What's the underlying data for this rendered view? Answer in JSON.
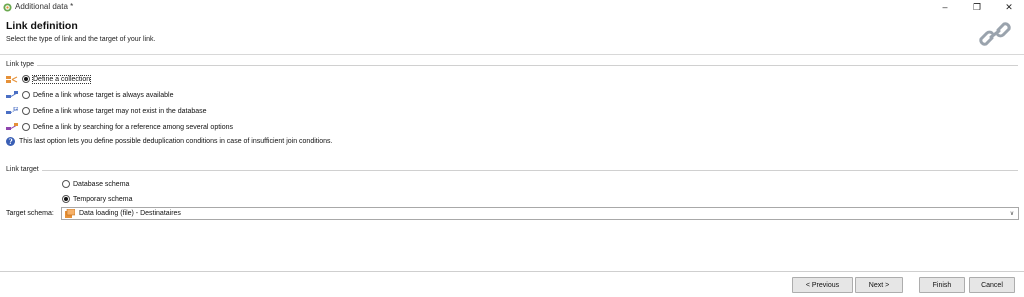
{
  "window": {
    "title": "Additional data *",
    "minimize_glyph": "–",
    "maximize_glyph": "❐",
    "close_glyph": "✕"
  },
  "header": {
    "title": "Link definition",
    "subtitle": "Select the type of link and the target of your link."
  },
  "link_type": {
    "group_label": "Link type",
    "options": [
      {
        "label": "Define a collection",
        "checked": true
      },
      {
        "label": "Define a link whose target is always available",
        "checked": false
      },
      {
        "label": "Define a link whose target may not exist in the database",
        "checked": false
      },
      {
        "label": "Define a link by searching for a reference among several options",
        "checked": false
      }
    ],
    "info_text": "This last option lets you define possible deduplication conditions in case of insufficient join conditions."
  },
  "link_target": {
    "group_label": "Link target",
    "options": [
      {
        "label": "Database schema",
        "checked": false
      },
      {
        "label": "Temporary schema",
        "checked": true
      }
    ],
    "target_schema_label": "Target schema:",
    "target_schema_value": "Data loading (file) - Destinataires"
  },
  "footer": {
    "previous_label": "< Previous",
    "next_label": "Next >",
    "finish_label": "Finish",
    "cancel_label": "Cancel"
  },
  "icons": {
    "app": "app-icon",
    "link": "chain-link-icon",
    "info": "info-icon",
    "info_glyph": "?",
    "dropdown": "chevron-down-icon",
    "dropdown_glyph": "∨"
  },
  "colors": {
    "accent_info": "#3a5fb5",
    "link_icon": "#9aa3ad"
  }
}
